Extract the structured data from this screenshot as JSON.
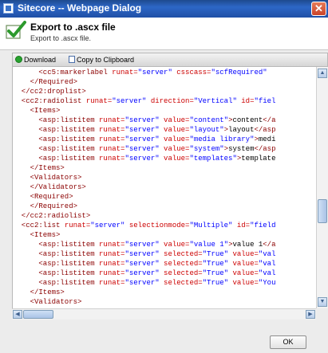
{
  "window": {
    "title": "Sitecore -- Webpage Dialog",
    "close_glyph": "✕"
  },
  "header": {
    "title": "Export to .ascx file",
    "subtitle": "Export to .ascx file.",
    "icon": "checkmark-icon"
  },
  "toolbar": {
    "download_label": "Download",
    "copy_label": "Copy to Clipboard"
  },
  "code_lines": [
    [
      [
        "t",
        "      <cc5:markerlabel "
      ],
      [
        "a",
        "runat="
      ],
      [
        "v",
        "\"server\" "
      ],
      [
        "a",
        "csscass="
      ],
      [
        "v",
        "\"scfRequired\" "
      ]
    ],
    [
      [
        "t",
        "    </Required>"
      ]
    ],
    [
      [
        "t",
        "  </cc2:droplist>"
      ]
    ],
    [
      [
        "t",
        "  <cc2:radiolist "
      ],
      [
        "a",
        "runat="
      ],
      [
        "v",
        "\"server\" "
      ],
      [
        "a",
        "direction="
      ],
      [
        "v",
        "\"Vertical\" "
      ],
      [
        "a",
        "id="
      ],
      [
        "v",
        "\"fiel"
      ]
    ],
    [
      [
        "t",
        "    <Items>"
      ]
    ],
    [
      [
        "t",
        "      <asp:listitem "
      ],
      [
        "a",
        "runat="
      ],
      [
        "v",
        "\"server\" "
      ],
      [
        "a",
        "value="
      ],
      [
        "v",
        "\"content\""
      ],
      [
        "t",
        ">"
      ],
      [
        "x",
        "content"
      ],
      [
        "t",
        "</a"
      ]
    ],
    [
      [
        "t",
        "      <asp:listitem "
      ],
      [
        "a",
        "runat="
      ],
      [
        "v",
        "\"server\" "
      ],
      [
        "a",
        "value="
      ],
      [
        "v",
        "\"layout\""
      ],
      [
        "t",
        ">"
      ],
      [
        "x",
        "layout"
      ],
      [
        "t",
        "</asp"
      ]
    ],
    [
      [
        "t",
        "      <asp:listitem "
      ],
      [
        "a",
        "runat="
      ],
      [
        "v",
        "\"server\" "
      ],
      [
        "a",
        "value="
      ],
      [
        "v",
        "\"media library\""
      ],
      [
        "t",
        ">"
      ],
      [
        "x",
        "medi"
      ]
    ],
    [
      [
        "t",
        "      <asp:listitem "
      ],
      [
        "a",
        "runat="
      ],
      [
        "v",
        "\"server\" "
      ],
      [
        "a",
        "value="
      ],
      [
        "v",
        "\"system\""
      ],
      [
        "t",
        ">"
      ],
      [
        "x",
        "system"
      ],
      [
        "t",
        "</asp"
      ]
    ],
    [
      [
        "t",
        "      <asp:listitem "
      ],
      [
        "a",
        "runat="
      ],
      [
        "v",
        "\"server\" "
      ],
      [
        "a",
        "value="
      ],
      [
        "v",
        "\"templates\""
      ],
      [
        "t",
        ">"
      ],
      [
        "x",
        "template"
      ]
    ],
    [
      [
        "t",
        "    </Items>"
      ]
    ],
    [
      [
        "t",
        "    <Validators>"
      ]
    ],
    [
      [
        "t",
        "    </Validators>"
      ]
    ],
    [
      [
        "t",
        "    <Required>"
      ]
    ],
    [
      [
        "t",
        "    </Required>"
      ]
    ],
    [
      [
        "t",
        "  </cc2:radiolist>"
      ]
    ],
    [
      [
        "t",
        "  <cc2:list "
      ],
      [
        "a",
        "runat="
      ],
      [
        "v",
        "\"server\" "
      ],
      [
        "a",
        "selectionmode="
      ],
      [
        "v",
        "\"Multiple\" "
      ],
      [
        "a",
        "id="
      ],
      [
        "v",
        "\"field"
      ]
    ],
    [
      [
        "t",
        "    <Items>"
      ]
    ],
    [
      [
        "t",
        "      <asp:listitem "
      ],
      [
        "a",
        "runat="
      ],
      [
        "v",
        "\"server\" "
      ],
      [
        "a",
        "value="
      ],
      [
        "v",
        "\"value 1\""
      ],
      [
        "t",
        ">"
      ],
      [
        "x",
        "value 1"
      ],
      [
        "t",
        "</a"
      ]
    ],
    [
      [
        "t",
        "      <asp:listitem "
      ],
      [
        "a",
        "runat="
      ],
      [
        "v",
        "\"server\" "
      ],
      [
        "a",
        "selected="
      ],
      [
        "v",
        "\"True\" "
      ],
      [
        "a",
        "value="
      ],
      [
        "v",
        "\"val"
      ]
    ],
    [
      [
        "t",
        "      <asp:listitem "
      ],
      [
        "a",
        "runat="
      ],
      [
        "v",
        "\"server\" "
      ],
      [
        "a",
        "selected="
      ],
      [
        "v",
        "\"True\" "
      ],
      [
        "a",
        "value="
      ],
      [
        "v",
        "\"val"
      ]
    ],
    [
      [
        "t",
        "      <asp:listitem "
      ],
      [
        "a",
        "runat="
      ],
      [
        "v",
        "\"server\" "
      ],
      [
        "a",
        "selected="
      ],
      [
        "v",
        "\"True\" "
      ],
      [
        "a",
        "value="
      ],
      [
        "v",
        "\"val"
      ]
    ],
    [
      [
        "t",
        "      <asp:listitem "
      ],
      [
        "a",
        "runat="
      ],
      [
        "v",
        "\"server\" "
      ],
      [
        "a",
        "selected="
      ],
      [
        "v",
        "\"True\" "
      ],
      [
        "a",
        "value="
      ],
      [
        "v",
        "\"You"
      ]
    ],
    [
      [
        "t",
        "    </Items>"
      ]
    ],
    [
      [
        "t",
        "    <Validators>"
      ]
    ]
  ],
  "scroll": {
    "vertical_position": 0.62,
    "horizontal_position": 0.0
  },
  "footer": {
    "ok_label": "OK"
  }
}
